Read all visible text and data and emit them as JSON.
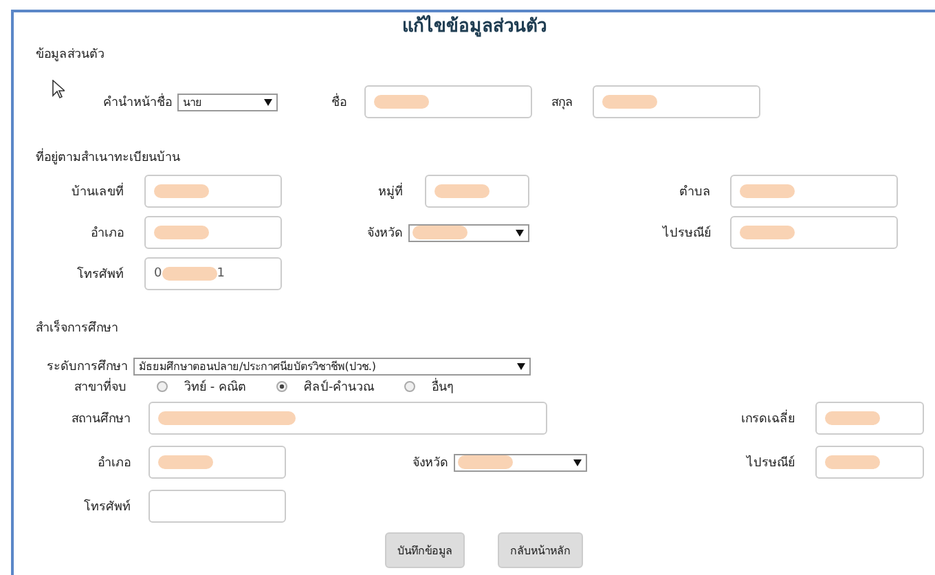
{
  "title": "แก้ไขข้อมูลส่วนตัว",
  "personal": {
    "heading": "ข้อมูลส่วนตัว",
    "fields": [
      {
        "label": "คำนำหน้าชื่อ",
        "kind": "select",
        "value": "นาย"
      },
      {
        "label": "ชื่อ",
        "kind": "input",
        "redacted": true
      },
      {
        "label": "สกุล",
        "kind": "input",
        "redacted": true
      }
    ]
  },
  "address": {
    "heading": "ที่อยู่ตามสำเนาทะเบียนบ้าน",
    "fields": [
      {
        "label": "บ้านเลขที่",
        "kind": "input",
        "redacted": true
      },
      {
        "label": "หมู่ที่",
        "kind": "input",
        "redacted": true
      },
      {
        "label": "ตำบล",
        "kind": "input",
        "redacted": true
      },
      {
        "label": "อำเภอ",
        "kind": "input",
        "redacted": true
      },
      {
        "label": "จังหวัด",
        "kind": "select",
        "redacted": true
      },
      {
        "label": "ไปรษณีย์",
        "kind": "input",
        "redacted": true
      },
      {
        "label": "โทรศัพท์",
        "kind": "input",
        "redacted": true,
        "value_parts": [
          "0",
          "1"
        ]
      }
    ]
  },
  "education": {
    "heading": "สำเร็จการศึกษา",
    "level": {
      "label": "ระดับการศึกษา",
      "value": "มัธยมศึกษาตอนปลาย/ประกาศนียบัตรวิชาชีพ(ปวช.)"
    },
    "branch": {
      "label": "สาขาที่จบ",
      "options": [
        {
          "label": "วิทย์ - คณิต",
          "selected": false
        },
        {
          "label": "ศิลป์-คำนวณ",
          "selected": true
        },
        {
          "label": "อื่นๆ",
          "selected": false
        }
      ]
    },
    "fields": [
      {
        "label": "สถานศึกษา",
        "kind": "input",
        "redacted": true
      },
      {
        "label": "เกรดเฉลี่ย",
        "kind": "input",
        "redacted": true
      },
      {
        "label": "อำเภอ",
        "kind": "input",
        "redacted": true
      },
      {
        "label": "จังหวัด",
        "kind": "select",
        "redacted": true
      },
      {
        "label": "ไปรษณีย์",
        "kind": "input",
        "redacted": true
      },
      {
        "label": "โทรศัพท์",
        "kind": "input",
        "redacted": false
      }
    ]
  },
  "buttons": [
    "บันทึกข้อมูล",
    "กลับหน้าหลัก"
  ]
}
